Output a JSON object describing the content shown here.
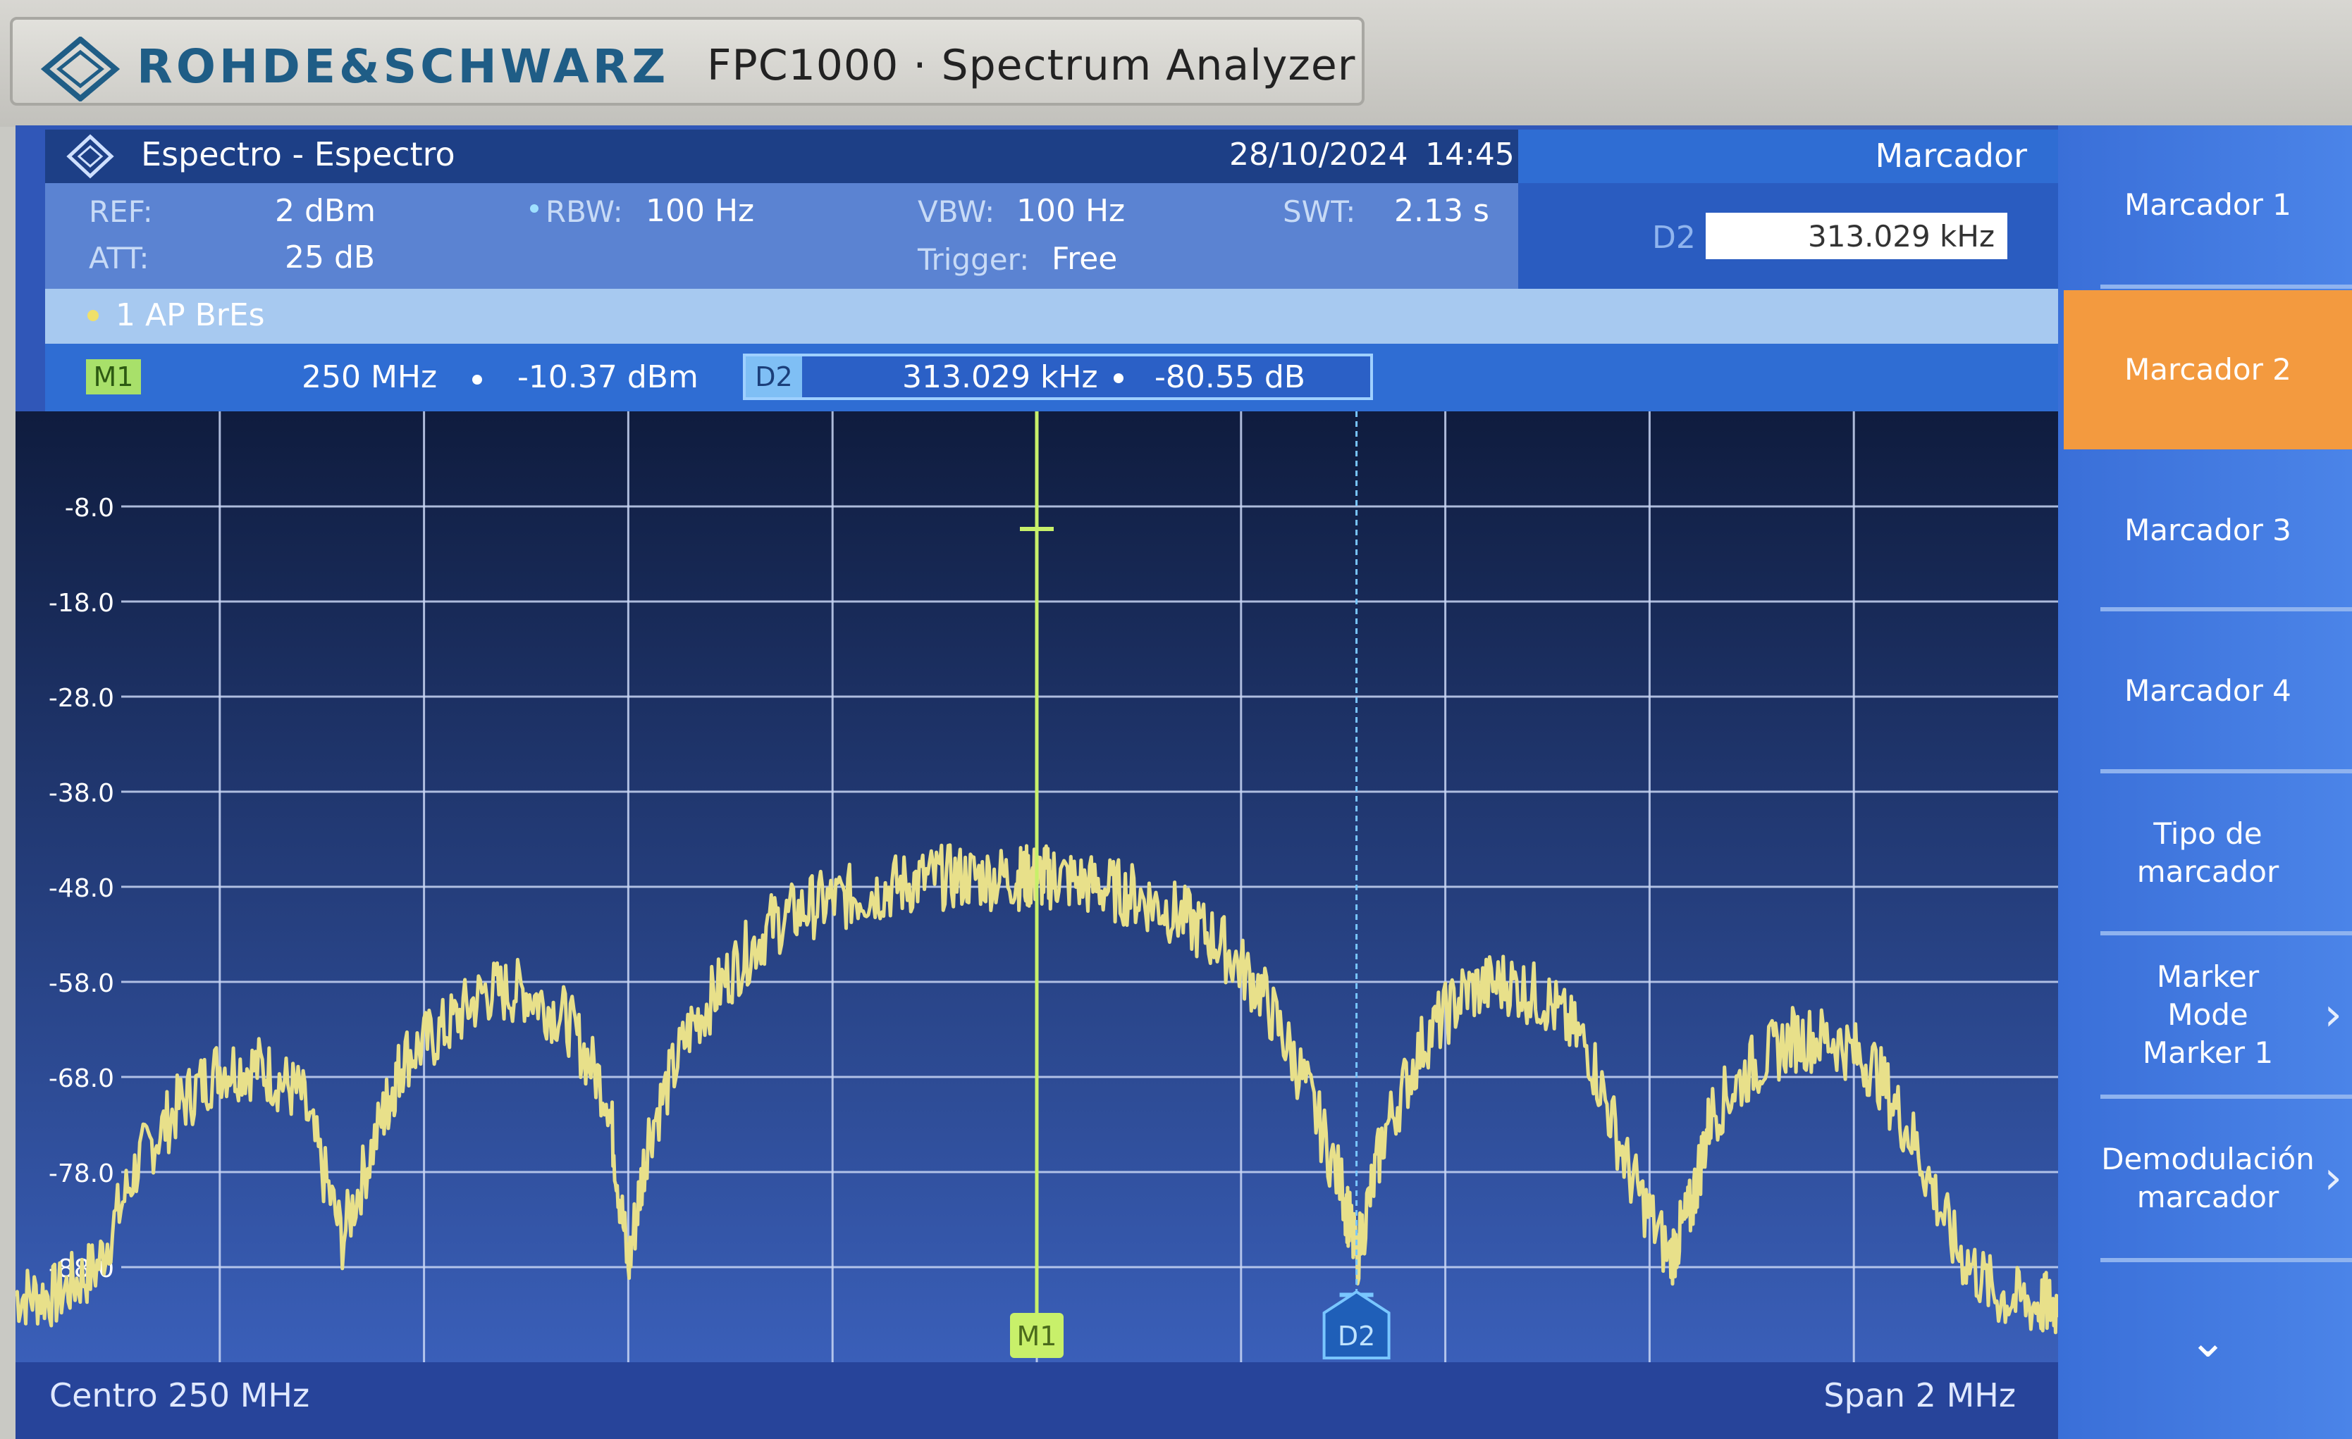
{
  "bezel": {
    "brand": "ROHDE&SCHWARZ",
    "model": "FPC1000 · Spectrum Analyzer"
  },
  "header": {
    "title": "Espectro - Espectro",
    "date": "28/10/2024",
    "time": "14:45"
  },
  "params": {
    "ref_label": "REF:",
    "ref_value": "2 dBm",
    "att_label": "ATT:",
    "att_value": "25 dB",
    "rbw_label": "RBW:",
    "rbw_value": "100 Hz",
    "vbw_label": "VBW:",
    "vbw_value": "100 Hz",
    "trigger_label": "Trigger:",
    "trigger_value": "Free",
    "swt_label": "SWT:",
    "swt_value": "2.13 s"
  },
  "marker_panel": {
    "title": "Marcador",
    "field_label": "D2",
    "field_value": "313.029 kHz"
  },
  "trace": {
    "label": "1 AP  BrEs"
  },
  "markers": {
    "m1": {
      "tag": "M1",
      "freq": "250 MHz",
      "level": "-10.37 dBm"
    },
    "d2": {
      "tag": "D2",
      "freq": "313.029 kHz",
      "level": "-80.55 dB"
    }
  },
  "footer": {
    "center": "Centro 250 MHz",
    "span": "Span 2 MHz"
  },
  "softkeys": [
    {
      "label": "Marcador 1"
    },
    {
      "label": "Marcador 2",
      "active": true
    },
    {
      "label": "Marcador 3"
    },
    {
      "label": "Marcador 4"
    },
    {
      "label": "Tipo de marcador"
    },
    {
      "label": "Marker Mode Marker 1",
      "chevron": "›"
    },
    {
      "label": "Demodulación marcador",
      "chevron": "›"
    },
    {
      "label": "⌄"
    }
  ],
  "colors": {
    "trace": "#e8e08a",
    "m1_line": "#c8f06a",
    "d2_line": "#79c6ff",
    "grid": "#c9d6f5",
    "plot_bg_top": "#0f1c3e",
    "plot_bg_bottom": "#3a5fb9",
    "active_softkey": "#f39a3f"
  },
  "chart_data": {
    "type": "line",
    "title": "",
    "xlabel": "",
    "ylabel": "",
    "x_unit": "MHz",
    "y_unit": "dBm",
    "xlim": [
      249.0,
      251.0
    ],
    "ylim": [
      -98.0,
      2.0
    ],
    "y_ticks": [
      -8.0,
      -18.0,
      -28.0,
      -38.0,
      -48.0,
      -58.0,
      -68.0,
      -78.0,
      -88.0
    ],
    "y_tick_labels": [
      "-8.0",
      "-18.0",
      "-28.0",
      "-38.0",
      "-48.0",
      "-58.0",
      "-68.0",
      "-78.0",
      "-88.0"
    ],
    "grid": true,
    "series": [
      {
        "x": [
          249.0,
          249.04,
          249.08,
          249.12,
          249.16,
          249.2,
          249.24,
          249.28,
          249.32,
          249.36,
          249.38,
          249.42,
          249.46,
          249.5,
          249.54,
          249.58,
          249.6,
          249.62,
          249.66,
          249.7,
          249.74,
          249.78,
          249.82,
          249.86,
          249.9,
          249.94,
          249.98,
          250.0,
          250.02,
          250.06,
          250.1,
          250.14,
          250.18,
          250.22,
          250.26,
          250.3,
          250.313,
          250.34,
          250.38,
          250.42,
          250.46,
          250.5,
          250.54,
          250.58,
          250.62,
          250.64,
          250.66,
          250.7,
          250.74,
          250.78,
          250.82,
          250.86,
          250.9,
          250.94,
          250.98,
          251.0
        ],
        "y": [
          -91,
          -91,
          -88,
          -77,
          -71,
          -67,
          -67,
          -70,
          -85,
          -72,
          -66,
          -63,
          -59,
          -59,
          -62,
          -70,
          -88,
          -74,
          -63,
          -57,
          -52,
          -50,
          -49,
          -48,
          -47,
          -47,
          -47,
          -47,
          -47,
          -48,
          -49,
          -51,
          -54,
          -59,
          -68,
          -80,
          -87,
          -74,
          -64,
          -59,
          -58,
          -60,
          -65,
          -78,
          -87,
          -82,
          -72,
          -67,
          -64,
          -64,
          -67,
          -75,
          -86,
          -91,
          -92,
          -92
        ]
      }
    ],
    "markers": [
      {
        "name": "M1",
        "x": 250.0,
        "y": -10.37
      },
      {
        "name": "D2",
        "x": 250.313029,
        "y": -90.92
      }
    ]
  }
}
